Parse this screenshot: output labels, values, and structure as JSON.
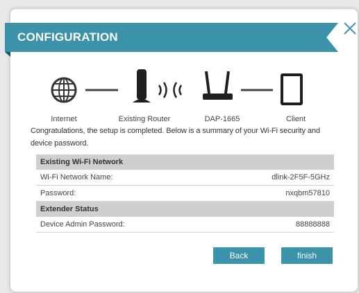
{
  "dialog": {
    "title": "CONFIGURATION",
    "accent_color": "#3a93a9"
  },
  "topology": {
    "devices": [
      {
        "name": "Internet",
        "icon": "globe-icon"
      },
      {
        "name": "Existing Router",
        "icon": "router-icon"
      },
      {
        "name": "DAP-1665",
        "icon": "access-point-icon"
      },
      {
        "name": "Client",
        "icon": "tablet-icon"
      }
    ],
    "wireless_icon": "wifi-waves-icon"
  },
  "summary_text": "Congratulations, the setup is completed. Below is a summary of your Wi-Fi security and device password.",
  "existing_network": {
    "header": "Existing Wi-Fi Network",
    "rows": [
      {
        "label": "Wi-Fi Network Name:",
        "value": "dlink-2F5F-5GHz"
      },
      {
        "label": "Password:",
        "value": "nxqbm57810"
      }
    ]
  },
  "extender_status": {
    "header": "Extender Status",
    "rows": [
      {
        "label": "Device Admin Password:",
        "value": "88888888"
      }
    ]
  },
  "buttons": {
    "back": "Back",
    "finish": "finish"
  }
}
